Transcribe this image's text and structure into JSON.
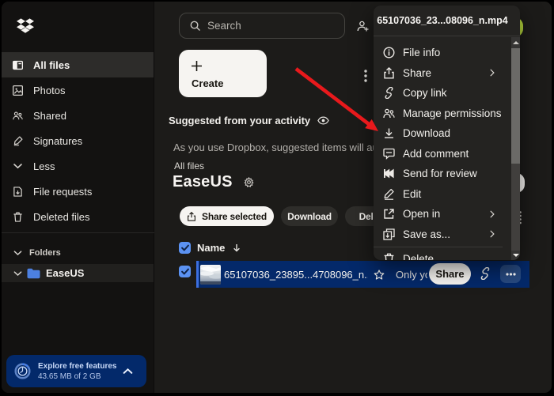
{
  "sidebar": {
    "nav": [
      {
        "label": "All files",
        "selected": true
      },
      {
        "label": "Photos",
        "selected": false
      },
      {
        "label": "Shared",
        "selected": false
      },
      {
        "label": "Signatures",
        "selected": false
      },
      {
        "label": "Less",
        "selected": false
      },
      {
        "label": "File requests",
        "selected": false
      },
      {
        "label": "Deleted files",
        "selected": false
      }
    ],
    "folders_header": "Folders",
    "folder_name": "EaseUS",
    "storage_card": {
      "title": "Explore free features",
      "usage": "43.65 MB of 2 GB"
    }
  },
  "topbar": {
    "search_placeholder": "Search"
  },
  "main": {
    "create_label": "Create",
    "suggested_title": "Suggested from your activity",
    "suggested_desc": "As you use Dropbox, suggested items will automatically show up here.",
    "breadcrumb": "All files",
    "page_title": "EaseUS",
    "toolbar": {
      "share_selected": "Share selected",
      "download": "Download",
      "delete": "Delete"
    },
    "table": {
      "name_header": "Name",
      "row": {
        "filename": "65107036_23895...4708096_n....",
        "access": "Only you",
        "share_label": "Share"
      }
    }
  },
  "context_menu": {
    "title": "65107036_23...08096_n.mp4",
    "items": [
      {
        "label": "File info",
        "icon": "info-icon",
        "submenu": false
      },
      {
        "label": "Share",
        "icon": "share-icon",
        "submenu": true
      },
      {
        "label": "Copy link",
        "icon": "copy-link-icon",
        "submenu": false
      },
      {
        "label": "Manage permissions",
        "icon": "permissions-icon",
        "submenu": false
      },
      {
        "label": "Download",
        "icon": "download-icon",
        "submenu": false
      },
      {
        "label": "Add comment",
        "icon": "comment-icon",
        "submenu": false
      },
      {
        "label": "Send for review",
        "icon": "review-icon",
        "submenu": false
      },
      {
        "label": "Edit",
        "icon": "edit-icon",
        "submenu": false
      },
      {
        "label": "Open in",
        "icon": "open-in-icon",
        "submenu": true
      },
      {
        "label": "Save as...",
        "icon": "save-as-icon",
        "submenu": true
      }
    ],
    "partial_item": {
      "label": "Delete",
      "icon": "trash-icon"
    }
  },
  "colors": {
    "selected_row_blue": "#04296a",
    "accent_blue": "#3c6fe0",
    "checkbox_blue": "#5b92f2",
    "storage_card_blue": "#03296a",
    "annotation_red": "#e8191c",
    "upgrade_green": "#b2d23b"
  }
}
